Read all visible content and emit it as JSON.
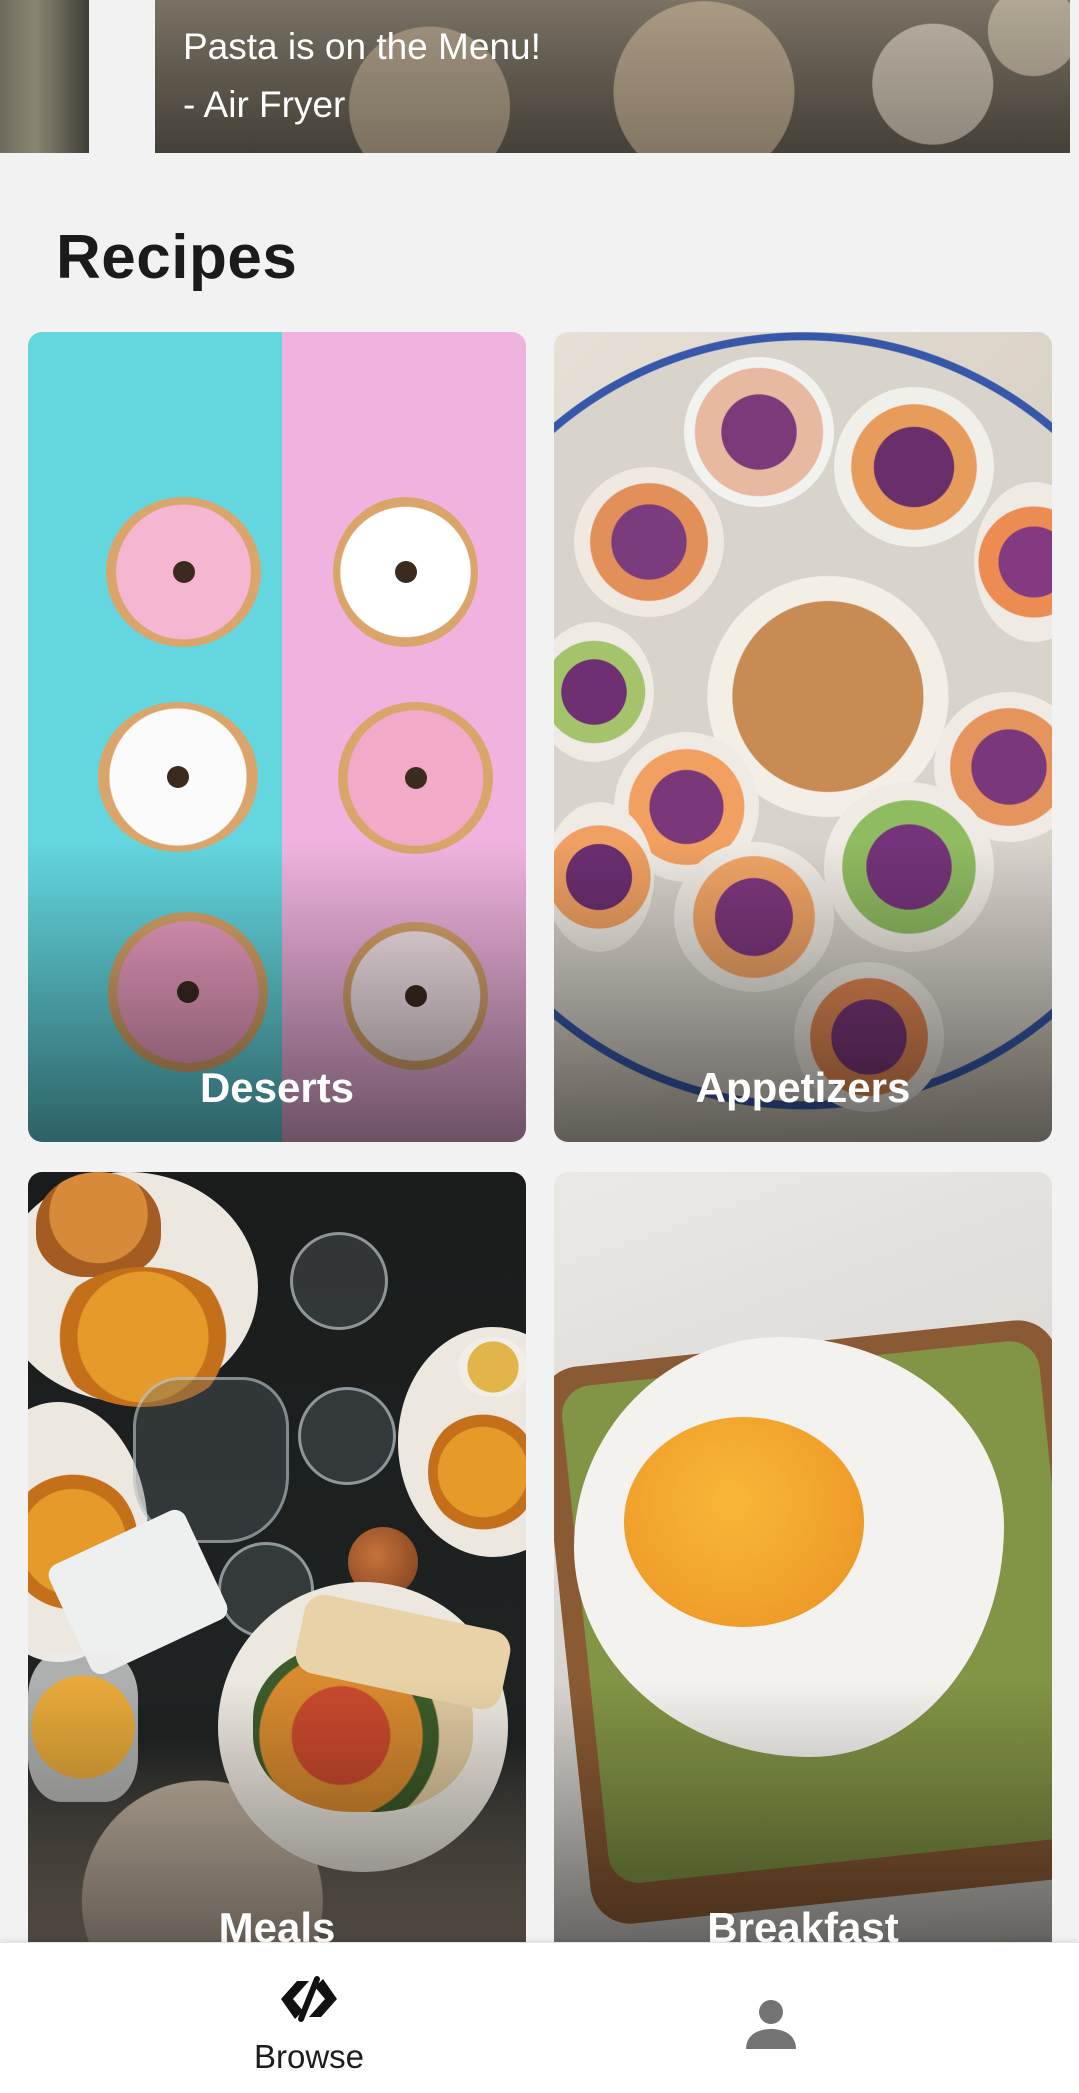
{
  "carousel": {
    "caption_line1": "Pasta is on the Menu!",
    "caption_line2": "- Air Fryer"
  },
  "section": {
    "title": "Recipes"
  },
  "categories": [
    {
      "label": "Deserts"
    },
    {
      "label": "Appetizers"
    },
    {
      "label": "Meals"
    },
    {
      "label": "Breakfast"
    }
  ],
  "bottom_nav": {
    "items": [
      {
        "label": "Browse",
        "icon": "browse-logo-icon",
        "active": true
      },
      {
        "label": "",
        "icon": "person-icon",
        "active": false
      }
    ]
  },
  "colors": {
    "background": "#f2f2f2",
    "text_dark": "#1b1b1b",
    "nav_active": "#1d1d1d",
    "nav_inactive": "#737373"
  }
}
